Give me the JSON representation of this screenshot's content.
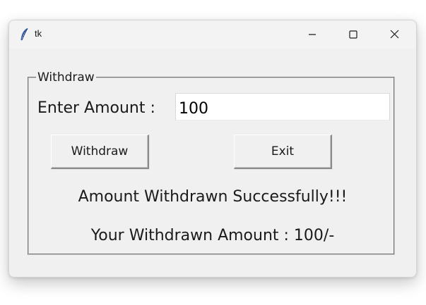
{
  "window": {
    "title": "tk",
    "icon": "feather-icon"
  },
  "controls": {
    "minimize": "minimize-icon",
    "maximize": "maximize-icon",
    "close": "close-icon"
  },
  "group": {
    "label": "Withdraw"
  },
  "form": {
    "amount_label": "Enter Amount :",
    "amount_value": "100"
  },
  "buttons": {
    "withdraw_label": "Withdraw",
    "exit_label": "Exit"
  },
  "messages": {
    "success": "Amount Withdrawn Successfully!!!",
    "withdrawn_amount": "Your Withdrawn Amount : 100/-"
  }
}
